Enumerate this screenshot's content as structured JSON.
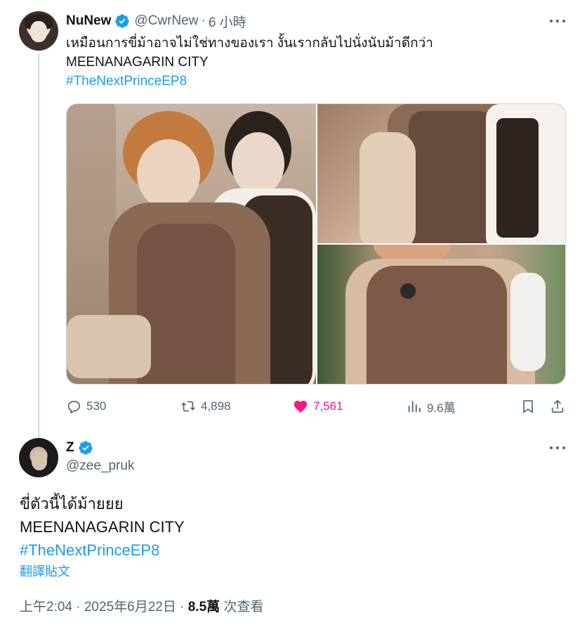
{
  "tweet1": {
    "display_name": "NuNew",
    "handle": "@CwrNew",
    "time": "6 小時",
    "text_line1": "เหมือนการขี่ม้าอาจไม่ใช่ทางของเรา งั้นเรากลับไปนั่งนับม้าดีกว่า",
    "text_line2": "MEENANAGARIN CITY",
    "hashtag": "#TheNextPrinceEP8",
    "replies": "530",
    "reposts": "4,898",
    "likes": "7,561",
    "views": "9.6萬"
  },
  "tweet2": {
    "display_name": "Z",
    "handle": "@zee_pruk",
    "text_line1": "ขี่ตัวนี้ได้ม้ายยย",
    "text_line2": "MEENANAGARIN CITY",
    "hashtag": "#TheNextPrinceEP8",
    "translate_label": "翻譯貼文",
    "timestamp": "上午2:04 · 2025年6月22日 ·",
    "views_count": "8.5萬",
    "views_label": "次查看"
  },
  "colors": {
    "accent": "#1d9bf0",
    "like": "#f91880",
    "secondary_text": "#536471"
  },
  "icons": [
    "verified-badge-icon",
    "more-icon",
    "reply-icon",
    "repost-icon",
    "like-icon",
    "views-icon",
    "bookmark-icon",
    "share-icon"
  ]
}
